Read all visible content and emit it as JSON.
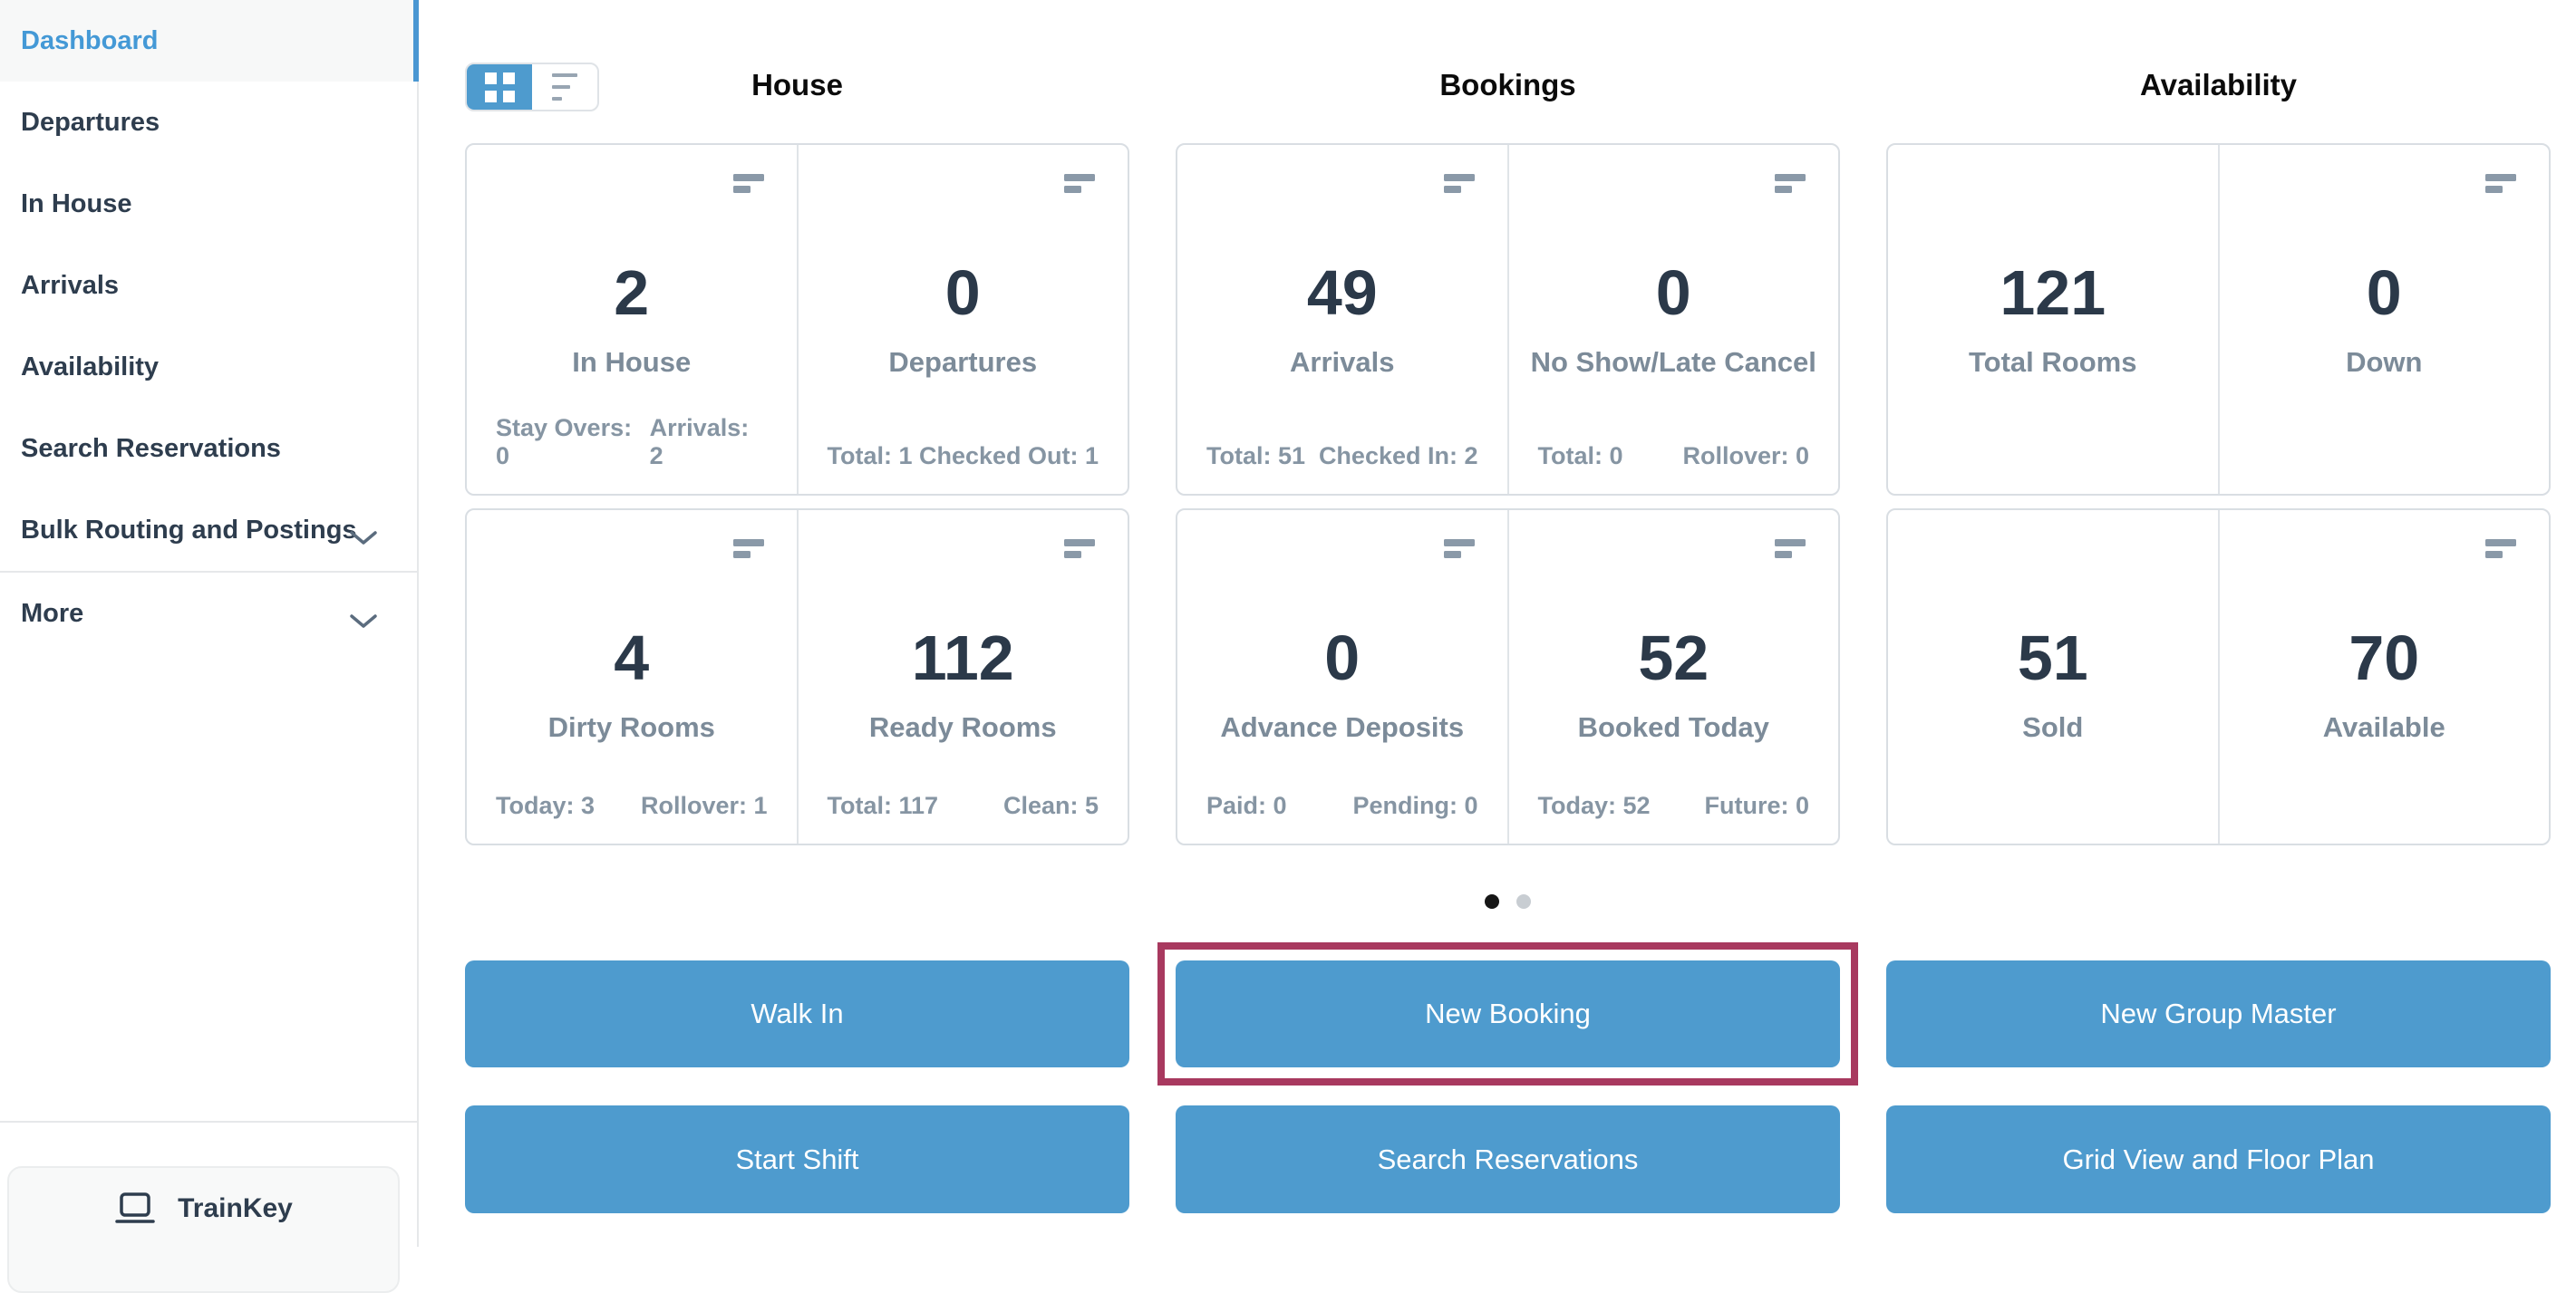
{
  "colors": {
    "accent_blue": "#4E9BCE",
    "active_link_blue": "#4499D6",
    "highlight_maroon": "#A8395F",
    "number_dark": "#2B3949",
    "label_gray": "#7C8B99",
    "card_border": "#D9DEE3"
  },
  "icons": {
    "grid_view": "grid-view-icon",
    "list_view": "list-view-icon",
    "tile_menu": "filter-bars-icon",
    "chevron": "chevron-down-icon",
    "laptop": "laptop-icon"
  },
  "sidebar": {
    "items": [
      {
        "label": "Dashboard",
        "active": true
      },
      {
        "label": "Departures"
      },
      {
        "label": "In House"
      },
      {
        "label": "Arrivals"
      },
      {
        "label": "Availability"
      },
      {
        "label": "Search Reservations"
      },
      {
        "label": "Bulk Routing and Postings",
        "expandable": true
      },
      {
        "label": "More",
        "expandable": true
      }
    ],
    "trainkey_label": "TrainKey"
  },
  "view_toggle": {
    "active": "grid"
  },
  "sections": [
    {
      "title": "House",
      "rows": [
        {
          "cells": [
            {
              "value": "2",
              "label": "In House",
              "stat_left": "Stay Overs: 0",
              "stat_right": "Arrivals: 2"
            },
            {
              "value": "0",
              "label": "Departures",
              "stat_left": "Total: 1",
              "stat_right": "Checked Out: 1"
            }
          ]
        },
        {
          "cells": [
            {
              "value": "4",
              "label": "Dirty Rooms",
              "stat_left": "Today: 3",
              "stat_right": "Rollover: 1"
            },
            {
              "value": "112",
              "label": "Ready Rooms",
              "stat_left": "Total: 117",
              "stat_right": "Clean: 5"
            }
          ]
        }
      ]
    },
    {
      "title": "Bookings",
      "rows": [
        {
          "cells": [
            {
              "value": "49",
              "label": "Arrivals",
              "stat_left": "Total: 51",
              "stat_right": "Checked In: 2"
            },
            {
              "value": "0",
              "label": "No Show/Late Cancel",
              "stat_left": "Total: 0",
              "stat_right": "Rollover: 0"
            }
          ]
        },
        {
          "cells": [
            {
              "value": "0",
              "label": "Advance Deposits",
              "stat_left": "Paid: 0",
              "stat_right": "Pending: 0"
            },
            {
              "value": "52",
              "label": "Booked Today",
              "stat_left": "Today: 52",
              "stat_right": "Future: 0"
            }
          ]
        }
      ]
    },
    {
      "title": "Availability",
      "rows": [
        {
          "cells": [
            {
              "value": "121",
              "label": "Total Rooms"
            },
            {
              "value": "0",
              "label": "Down"
            }
          ]
        },
        {
          "cells": [
            {
              "value": "51",
              "label": "Sold"
            },
            {
              "value": "70",
              "label": "Available"
            }
          ]
        }
      ]
    }
  ],
  "carousel": {
    "count": 2,
    "active_index": 0
  },
  "buttons": {
    "row1": [
      "Walk In",
      "New Booking",
      "New Group Master"
    ],
    "row2": [
      "Start Shift",
      "Search Reservations",
      "Grid View and Floor Plan"
    ],
    "highlighted": "New Booking"
  }
}
